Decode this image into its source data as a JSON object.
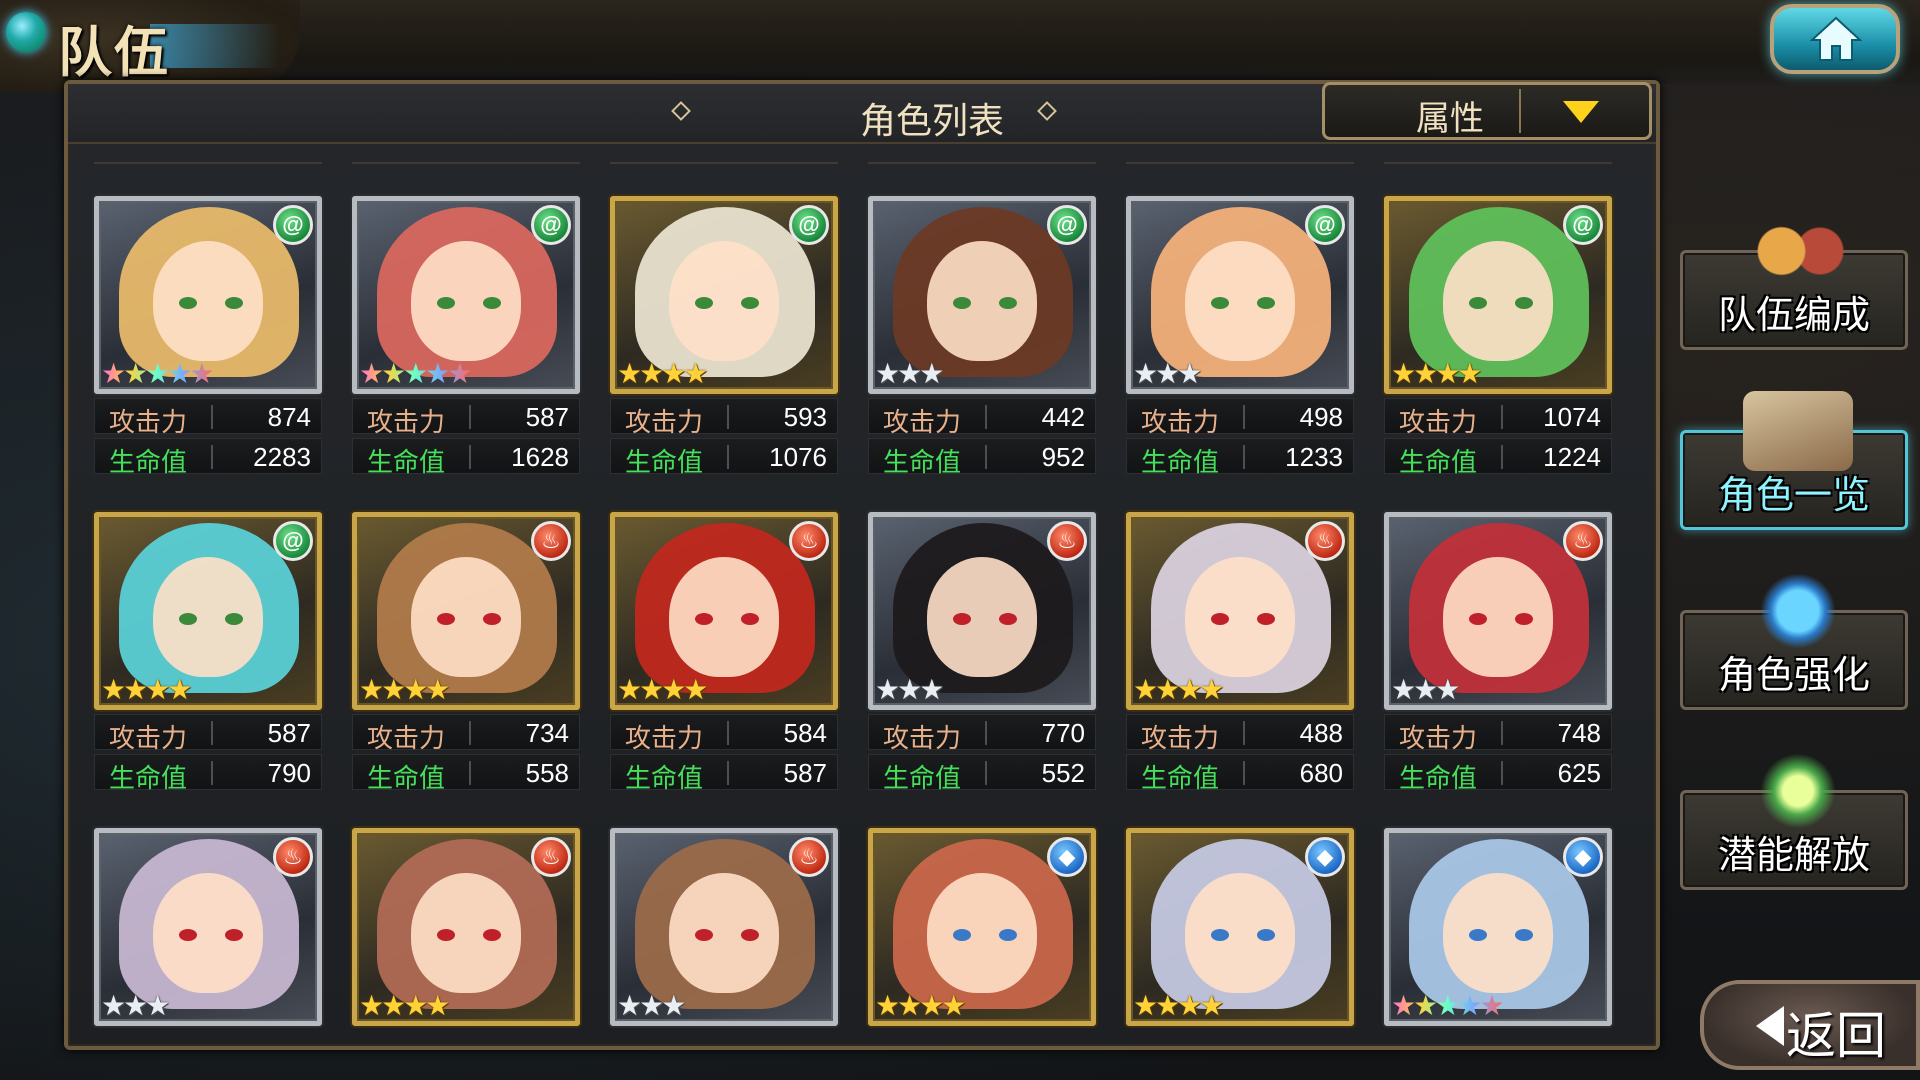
{
  "header": {
    "title": "队伍"
  },
  "panel": {
    "title": "角色列表",
    "filter_label": "属性"
  },
  "stat_labels": {
    "attack": "攻击力",
    "hp": "生命值"
  },
  "colors": {
    "gold_frame": "#c9a64a",
    "silver_frame": "#b7bcc3",
    "attack_label": "#e8b08a",
    "hp_label": "#44e05a",
    "active_menu": "#52c6d8"
  },
  "characters": [
    {
      "element": "wind",
      "element_icon": "wind-icon",
      "frame": "silver",
      "stars": 5,
      "star_style": "rainbow",
      "attack": "874",
      "hp": "2283",
      "hair": "#e7b96a"
    },
    {
      "element": "wind",
      "element_icon": "wind-icon",
      "frame": "silver",
      "stars": 5,
      "star_style": "rainbow",
      "attack": "587",
      "hp": "1628",
      "hair": "#d8675e"
    },
    {
      "element": "wind",
      "element_icon": "wind-icon",
      "frame": "gold",
      "stars": 4,
      "star_style": "gold",
      "attack": "593",
      "hp": "1076",
      "hair": "#e8e2cf"
    },
    {
      "element": "wind",
      "element_icon": "wind-icon",
      "frame": "silver",
      "stars": 3,
      "star_style": "silver",
      "attack": "442",
      "hp": "952",
      "hair": "#6b3a25"
    },
    {
      "element": "wind",
      "element_icon": "wind-icon",
      "frame": "silver",
      "stars": 3,
      "star_style": "silver",
      "attack": "498",
      "hp": "1233",
      "hair": "#f2b07a"
    },
    {
      "element": "wind",
      "element_icon": "wind-icon",
      "frame": "gold",
      "stars": 4,
      "star_style": "gold",
      "attack": "1074",
      "hp": "1224",
      "hair": "#5fbf5a"
    },
    {
      "element": "wind",
      "element_icon": "wind-icon",
      "frame": "gold",
      "stars": 4,
      "star_style": "gold",
      "attack": "587",
      "hp": "790",
      "hair": "#5ad0d6"
    },
    {
      "element": "fire",
      "element_icon": "fire-icon",
      "frame": "gold",
      "stars": 4,
      "star_style": "gold",
      "attack": "734",
      "hp": "558",
      "hair": "#b07a4a"
    },
    {
      "element": "fire",
      "element_icon": "fire-icon",
      "frame": "gold",
      "stars": 4,
      "star_style": "gold",
      "attack": "584",
      "hp": "587",
      "hair": "#c0281e"
    },
    {
      "element": "fire",
      "element_icon": "fire-icon",
      "frame": "silver",
      "stars": 3,
      "star_style": "silver",
      "attack": "770",
      "hp": "552",
      "hair": "#1e1a1c"
    },
    {
      "element": "fire",
      "element_icon": "fire-icon",
      "frame": "gold",
      "stars": 4,
      "star_style": "gold",
      "attack": "488",
      "hp": "680",
      "hair": "#d8d0dc"
    },
    {
      "element": "fire",
      "element_icon": "fire-icon",
      "frame": "silver",
      "stars": 3,
      "star_style": "silver",
      "attack": "748",
      "hp": "625",
      "hair": "#c0303a"
    },
    {
      "element": "fire",
      "element_icon": "fire-icon",
      "frame": "silver",
      "stars": 3,
      "star_style": "silver",
      "attack": null,
      "hp": null,
      "hair": "#c6b6d0"
    },
    {
      "element": "fire",
      "element_icon": "fire-icon",
      "frame": "gold",
      "stars": 4,
      "star_style": "gold",
      "attack": null,
      "hp": null,
      "hair": "#b06a55"
    },
    {
      "element": "fire",
      "element_icon": "fire-icon",
      "frame": "silver",
      "stars": 3,
      "star_style": "silver",
      "attack": null,
      "hp": null,
      "hair": "#9a6a4a"
    },
    {
      "element": "water",
      "element_icon": "water-icon",
      "frame": "gold",
      "stars": 4,
      "star_style": "gold",
      "attack": null,
      "hp": null,
      "hair": "#c8664a"
    },
    {
      "element": "water",
      "element_icon": "water-icon",
      "frame": "gold",
      "stars": 4,
      "star_style": "gold",
      "attack": null,
      "hp": null,
      "hair": "#c4c8e0"
    },
    {
      "element": "water",
      "element_icon": "water-icon",
      "frame": "silver",
      "stars": 5,
      "star_style": "rainbow",
      "attack": null,
      "hp": null,
      "hair": "#a8c6e6"
    }
  ],
  "side_menu": [
    {
      "label": "队伍编成",
      "icon": "team-characters-icon",
      "active": false
    },
    {
      "label": "角色一览",
      "icon": "open-book-icon",
      "active": true
    },
    {
      "label": "角色强化",
      "icon": "enhance-crystal-icon",
      "active": false
    },
    {
      "label": "潜能解放",
      "icon": "potential-orb-icon",
      "active": false
    }
  ],
  "back_label": "返回"
}
